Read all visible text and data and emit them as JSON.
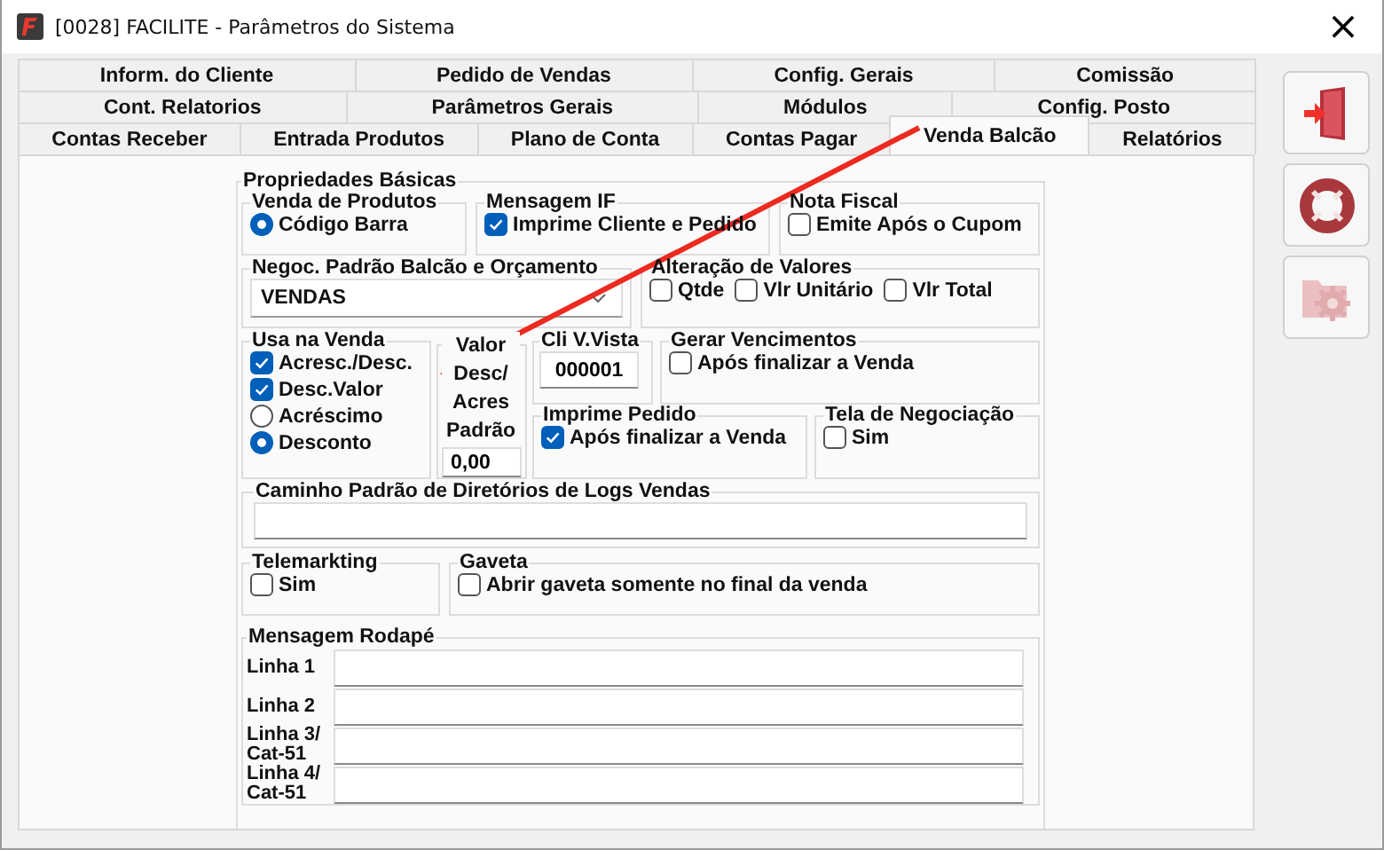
{
  "window": {
    "title": "[0028] FACILITE - Parâmetros do Sistema",
    "close_glyph": "×"
  },
  "tab_rows": [
    [
      {
        "label": "Inform. do Cliente",
        "selected": false
      },
      {
        "label": "Pedido de Vendas",
        "selected": false
      },
      {
        "label": "Config. Gerais",
        "selected": false
      },
      {
        "label": "Comissão",
        "selected": false
      }
    ],
    [
      {
        "label": "Cont. Relatorios",
        "selected": false
      },
      {
        "label": "Parâmetros Gerais",
        "selected": false
      },
      {
        "label": "Módulos",
        "selected": false
      },
      {
        "label": "Config. Posto",
        "selected": false
      }
    ],
    [
      {
        "label": "Contas Receber",
        "selected": false
      },
      {
        "label": "Entrada Produtos",
        "selected": false
      },
      {
        "label": "Plano de Conta",
        "selected": false
      },
      {
        "label": "Contas Pagar",
        "selected": false
      },
      {
        "label": "Venda Balcão",
        "selected": true
      },
      {
        "label": "Relatórios",
        "selected": false
      }
    ]
  ],
  "section_title": "Propriedades Básicas",
  "groups": {
    "venda_de_produtos": {
      "title": "Venda de Produtos",
      "controls": [
        {
          "kind": "radio",
          "label": "Código Barra",
          "selected": true
        }
      ]
    },
    "mensagem_if": {
      "title": "Mensagem IF",
      "controls": [
        {
          "kind": "checkbox",
          "label": "Imprime Cliente e Pedido",
          "checked": true
        }
      ]
    },
    "nota_fiscal": {
      "title": "Nota Fiscal",
      "controls": [
        {
          "kind": "checkbox",
          "label": "Emite Após o Cupom",
          "checked": false
        }
      ]
    },
    "negociacao": {
      "title": "Negoc. Padrão Balcão e Orçamento",
      "controls": [
        {
          "kind": "combo",
          "value": "VENDAS"
        }
      ]
    },
    "alteracao_de_valores": {
      "title": "Alteração de Valores",
      "controls": [
        {
          "kind": "checkbox",
          "label": "Qtde",
          "checked": false
        },
        {
          "kind": "checkbox",
          "label": "Vlr Unitário",
          "checked": false
        },
        {
          "kind": "checkbox",
          "label": "Vlr Total",
          "checked": false
        }
      ]
    },
    "usa_na_venda": {
      "title": "Usa na Venda",
      "controls": [
        {
          "kind": "checkbox",
          "label": "Acresc./Desc.",
          "checked": true
        },
        {
          "kind": "checkbox",
          "label": "Desc.Valor",
          "checked": true
        },
        {
          "kind": "radio",
          "label": "Acréscimo",
          "selected": false
        },
        {
          "kind": "radio",
          "label": "Desconto",
          "selected": true
        }
      ]
    },
    "valor_padrao": {
      "title": "Valor Desc/ Acres Padrão",
      "controls": [
        {
          "kind": "field",
          "value": "0,00"
        }
      ]
    },
    "cli_v_vista": {
      "title": "Cli V.Vista",
      "controls": [
        {
          "kind": "field",
          "value": "000001"
        }
      ]
    },
    "gerar_vencimentos": {
      "title": "Gerar Vencimentos",
      "controls": [
        {
          "kind": "checkbox",
          "label": "Após finalizar a Venda",
          "checked": false
        }
      ]
    },
    "imprime_pedido": {
      "title": "Imprime Pedido",
      "controls": [
        {
          "kind": "checkbox",
          "label": "Após finalizar a Venda",
          "checked": true
        }
      ]
    },
    "tela_de_negociacao": {
      "title": "Tela de Negociação",
      "controls": [
        {
          "kind": "checkbox",
          "label": "Sim",
          "checked": false
        }
      ]
    },
    "caminho_logs": {
      "title": "Caminho Padrão de Diretórios de Logs Vendas",
      "controls": [
        {
          "kind": "field"
        }
      ]
    },
    "telemarkting": {
      "title": "Telemarkting",
      "controls": [
        {
          "kind": "checkbox",
          "label": "Sim",
          "checked": false
        }
      ]
    },
    "gaveta": {
      "title": "Gaveta",
      "controls": [
        {
          "kind": "checkbox",
          "label": "Abrir gaveta somente no final da venda",
          "checked": false
        }
      ]
    }
  },
  "mensagem_rodape": {
    "title": "Mensagem Rodapé",
    "lines": [
      {
        "label": "Linha 1"
      },
      {
        "label": "Linha 2"
      },
      {
        "label": "Linha 3/ Cat-51"
      },
      {
        "label": "Linha 4/ Cat-51"
      }
    ]
  },
  "sidebar_buttons": [
    {
      "kind": "exit",
      "disabled": false
    },
    {
      "kind": "help",
      "disabled": false
    },
    {
      "kind": "settings",
      "disabled": true
    }
  ]
}
